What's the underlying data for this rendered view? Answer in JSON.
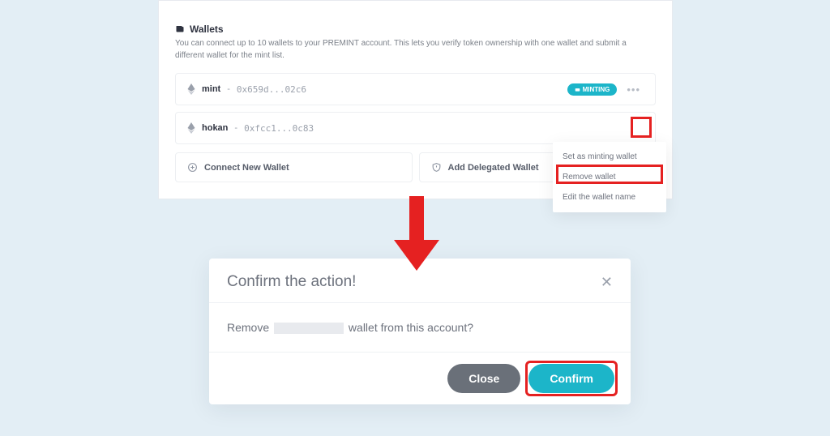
{
  "panel": {
    "title": "Wallets",
    "desc": "You can connect up to 10 wallets to your PREMINT account. This lets you verify token ownership with one wallet and submit a different wallet for the mint list.",
    "wallets": [
      {
        "name": "mint",
        "address": "0x659d...02c6",
        "badge": "MINTING"
      },
      {
        "name": "hokan",
        "address": "0xfcc1...0c83"
      }
    ],
    "connect_label": "Connect New Wallet",
    "delegated_label": "Add Delegated Wallet"
  },
  "dropdown": {
    "set_minting": "Set as minting wallet",
    "remove": "Remove wallet",
    "edit": "Edit the wallet name"
  },
  "modal": {
    "title": "Confirm the action!",
    "body_prefix": "Remove",
    "body_suffix": "wallet from this account?",
    "close": "Close",
    "confirm": "Confirm"
  }
}
